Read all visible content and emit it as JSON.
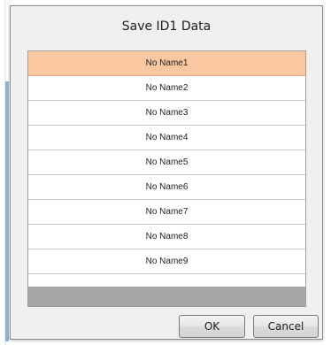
{
  "dialog": {
    "title": "Save ID1 Data",
    "rows": [
      {
        "label": "No Name1",
        "selected": true
      },
      {
        "label": "No Name2",
        "selected": false
      },
      {
        "label": "No Name3",
        "selected": false
      },
      {
        "label": "No Name4",
        "selected": false
      },
      {
        "label": "No Name5",
        "selected": false
      },
      {
        "label": "No Name6",
        "selected": false
      },
      {
        "label": "No Name7",
        "selected": false
      },
      {
        "label": "No Name8",
        "selected": false
      },
      {
        "label": "No Name9",
        "selected": false
      }
    ],
    "ok_label": "OK",
    "cancel_label": "Cancel"
  },
  "colors": {
    "selected_row": "#fbc7a1",
    "list_footer": "#a7a7a7",
    "dialog_bg": "#f0f0f0"
  }
}
